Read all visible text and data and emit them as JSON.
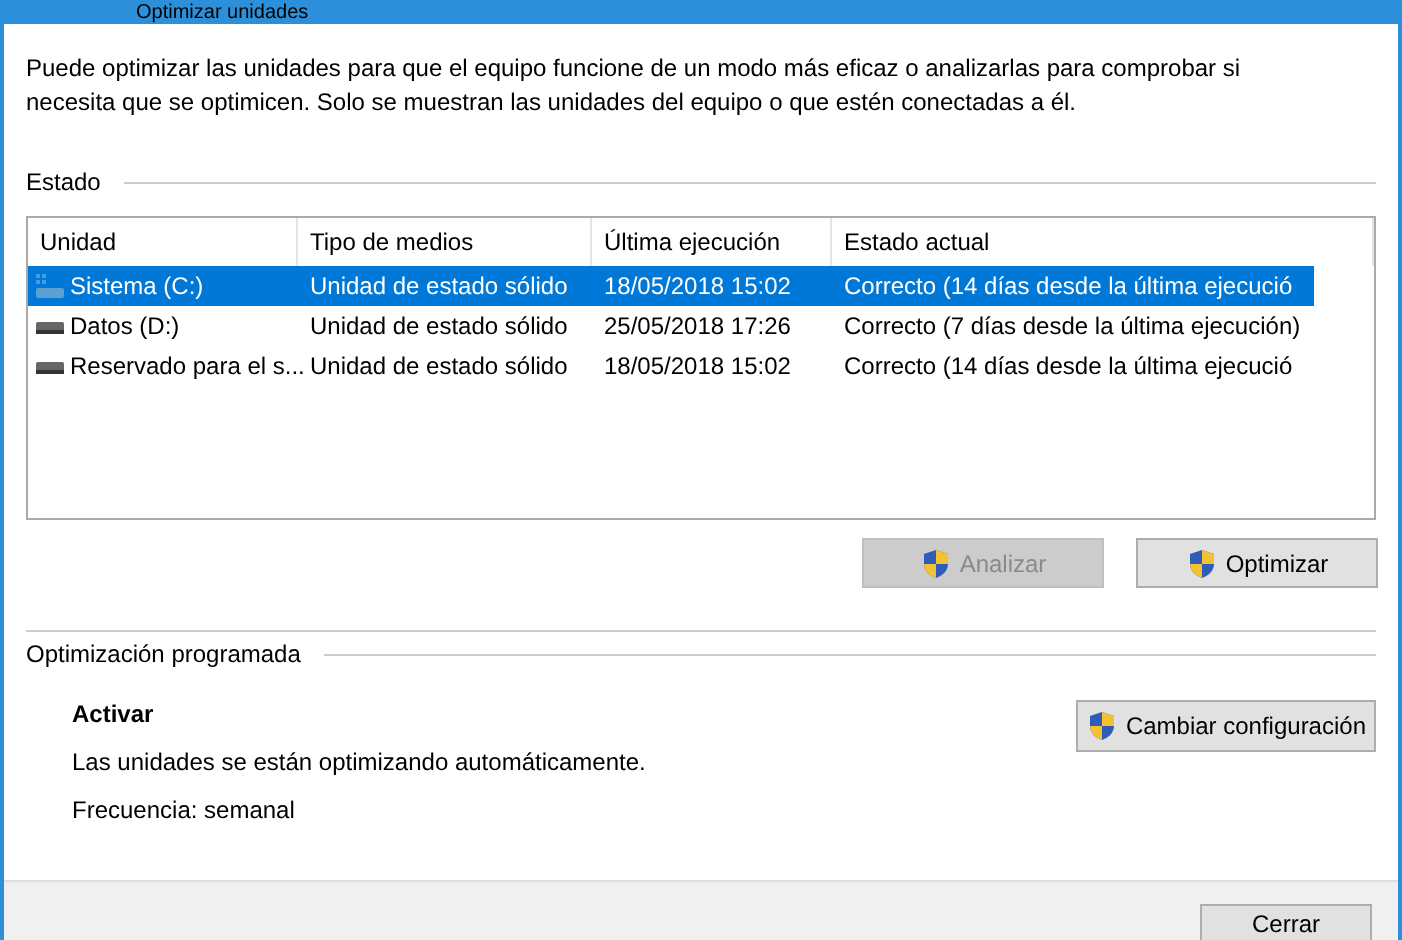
{
  "window": {
    "title": "Optimizar unidades"
  },
  "intro": "Puede optimizar las unidades para que el equipo funcione de un modo más eficaz o analizarlas para comprobar si necesita que se optimicen. Solo se muestran las unidades del equipo o que estén conectadas a él.",
  "status_section": {
    "label": "Estado"
  },
  "table": {
    "columns": [
      "Unidad",
      "Tipo de medios",
      "Última ejecución",
      "Estado actual"
    ],
    "rows": [
      {
        "cells": [
          "Sistema (C:)",
          "Unidad de estado sólido",
          "18/05/2018 15:02",
          "Correcto (14 días desde la última ejecució"
        ],
        "selected": true,
        "kind": "system"
      },
      {
        "cells": [
          "Datos (D:)",
          "Unidad de estado sólido",
          "25/05/2018 17:26",
          "Correcto (7 días desde la última ejecución)"
        ],
        "selected": false,
        "kind": "drive"
      },
      {
        "cells": [
          "Reservado para el s...",
          "Unidad de estado sólido",
          "18/05/2018 15:02",
          "Correcto (14 días desde la última ejecució"
        ],
        "selected": false,
        "kind": "drive"
      }
    ]
  },
  "actions": [
    {
      "label": "Analizar",
      "disabled": true
    },
    {
      "label": "Optimizar",
      "disabled": false
    }
  ],
  "scheduled": {
    "label": "Optimización programada",
    "state": "Activar",
    "description": "Las unidades se están optimizando automáticamente.",
    "frequency": "Frecuencia: semanal",
    "button": "Cambiar configuración"
  },
  "footer": {
    "button": "Cerrar"
  }
}
